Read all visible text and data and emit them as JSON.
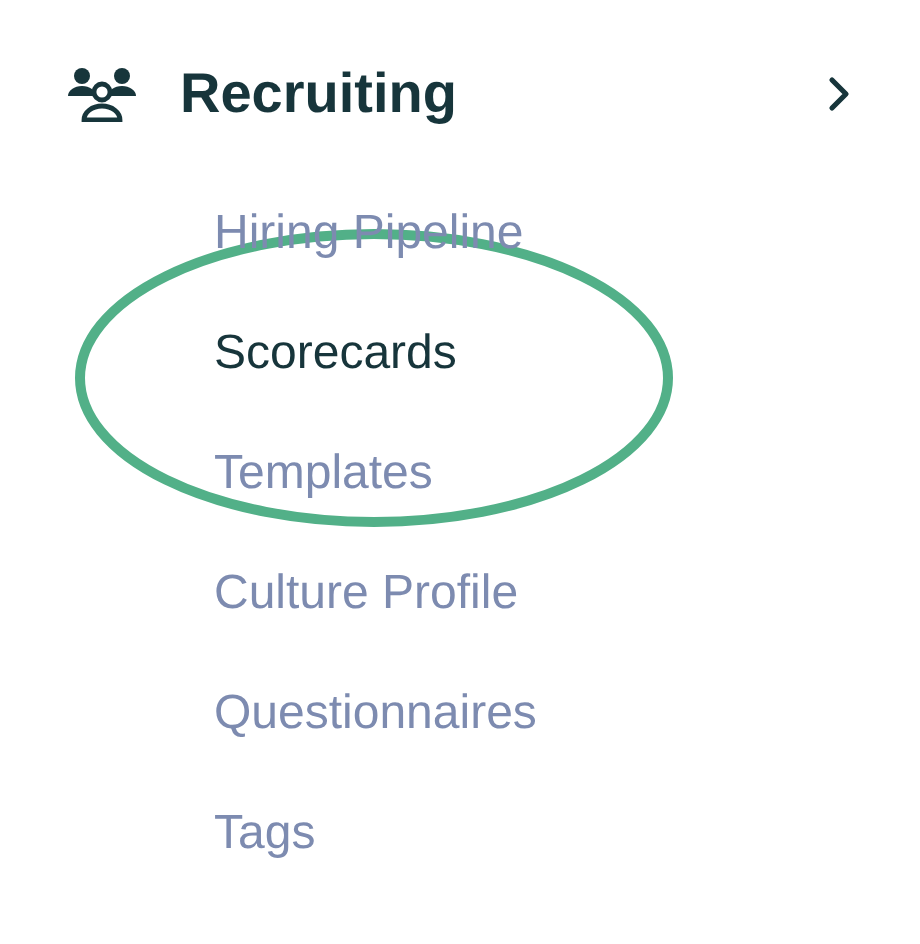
{
  "section": {
    "title": "Recruiting"
  },
  "items": [
    {
      "label": "Hiring Pipeline",
      "selected": false,
      "highlighted": false
    },
    {
      "label": "Scorecards",
      "selected": true,
      "highlighted": true
    },
    {
      "label": "Templates",
      "selected": false,
      "highlighted": false
    },
    {
      "label": "Culture Profile",
      "selected": false,
      "highlighted": false
    },
    {
      "label": "Questionnaires",
      "selected": false,
      "highlighted": false
    },
    {
      "label": "Tags",
      "selected": false,
      "highlighted": false
    }
  ]
}
